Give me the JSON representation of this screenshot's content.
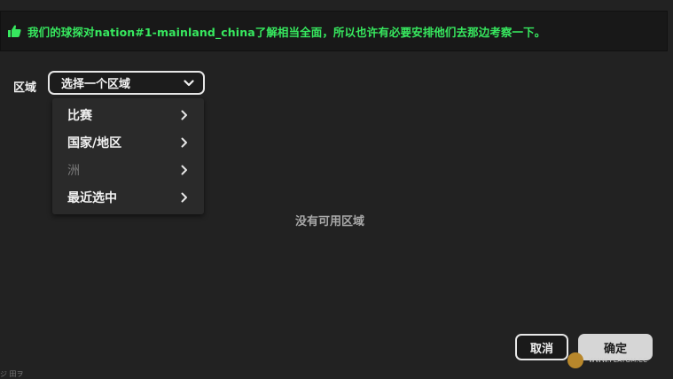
{
  "banner": {
    "icon": "thumbs-up-icon",
    "text": "我们的球探对nation#1-mainland_china了解相当全面，所以也许有必要安排他们去那边考察一下。",
    "color": "#37e95f"
  },
  "region": {
    "label": "区域",
    "selected": "选择一个区域"
  },
  "menu": {
    "items": [
      {
        "label": "比赛",
        "enabled": true
      },
      {
        "label": "国家/地区",
        "enabled": true
      },
      {
        "label": "洲",
        "enabled": false
      },
      {
        "label": "最近选中",
        "enabled": true
      }
    ]
  },
  "main": {
    "empty_message": "没有可用区域"
  },
  "footer": {
    "cancel_label": "取消",
    "ok_label": "确定"
  },
  "watermark": {
    "text": "WWW.PLAYGM.CC"
  },
  "corner": {
    "text": "ジ 田ヲ"
  }
}
